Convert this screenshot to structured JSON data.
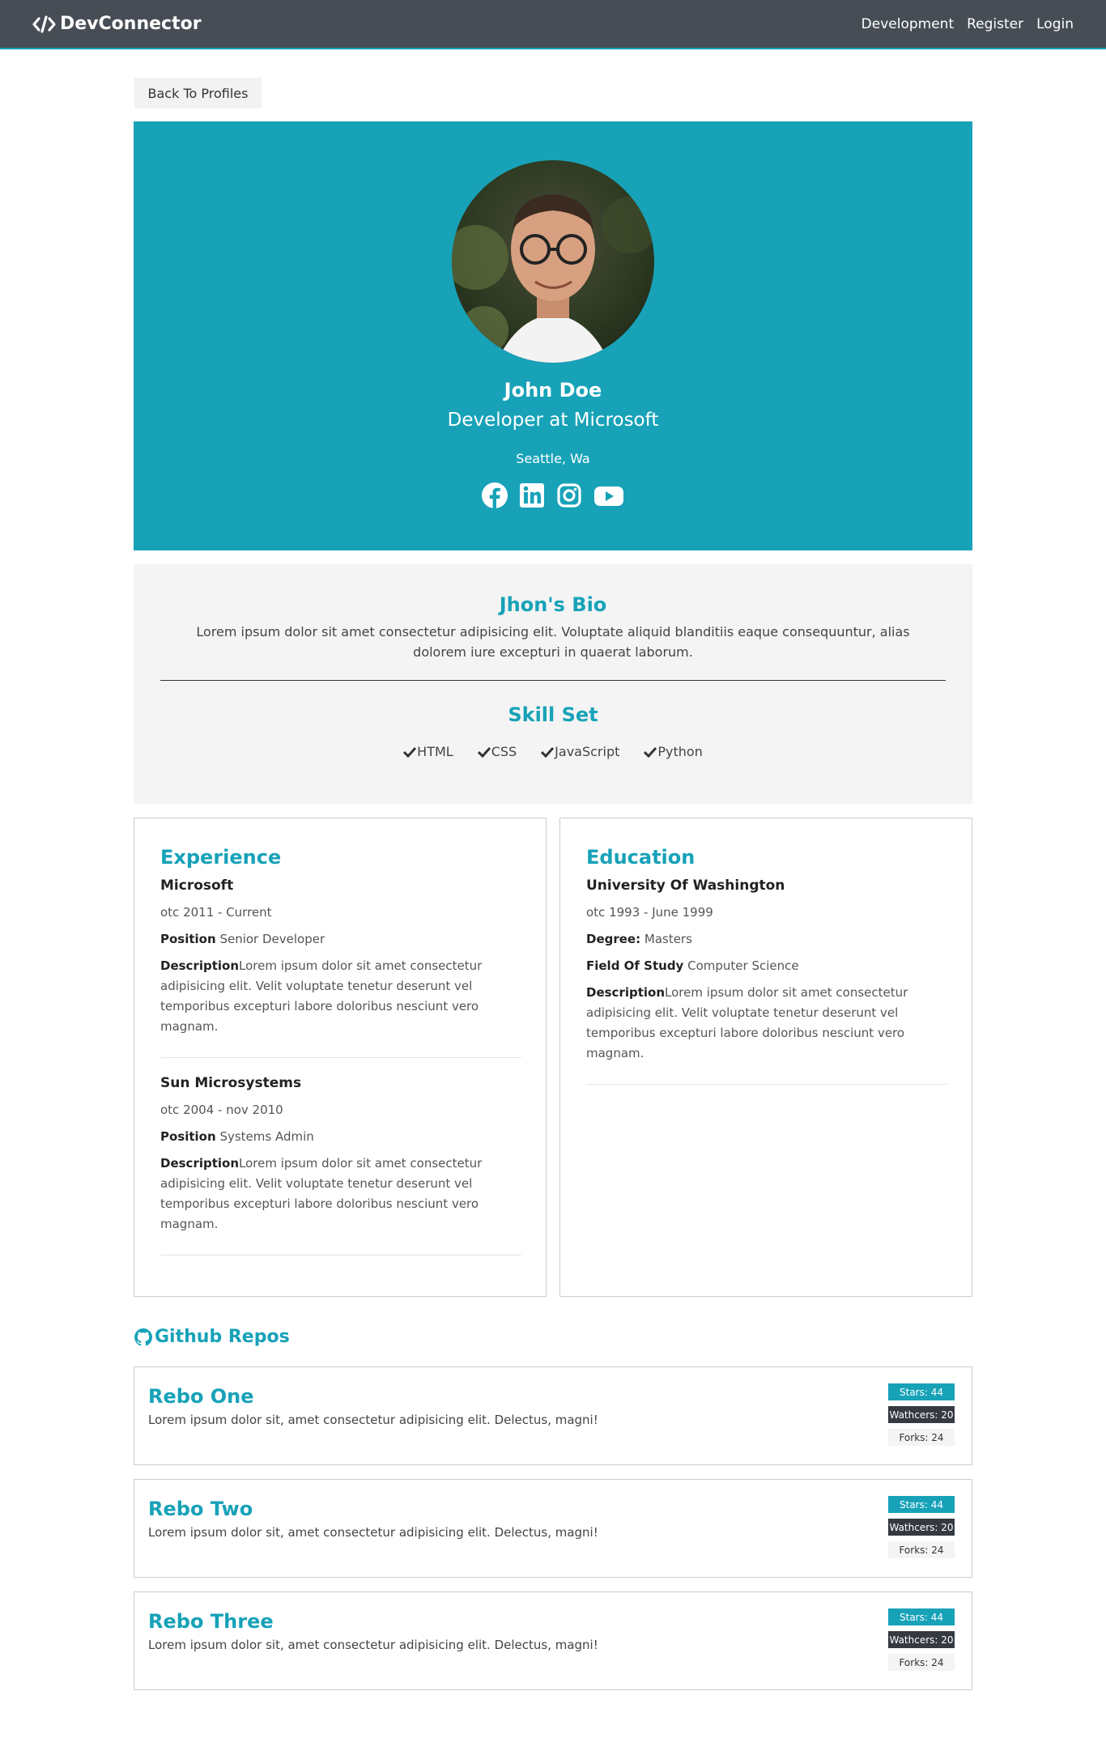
{
  "navbar": {
    "brand": "DevConnector",
    "links": [
      "Development",
      "Register",
      "Login"
    ]
  },
  "back_button": "Back To Profiles",
  "profile": {
    "name": "John Doe",
    "title": "Developer at Microsoft",
    "location": "Seattle, Wa",
    "socials": [
      "facebook-icon",
      "linkedin-icon",
      "instagram-icon",
      "youtube-icon"
    ]
  },
  "about": {
    "bio_heading": "Jhon's Bio",
    "bio_text": "Lorem ipsum dolor sit amet consectetur adipisicing elit. Voluptate aliquid blanditiis eaque consequuntur, alias dolorem iure excepturi in quaerat laborum.",
    "skills_heading": "Skill Set",
    "skills": [
      "HTML",
      "CSS",
      "JavaScript",
      "Python"
    ]
  },
  "experience": {
    "heading": "Experience",
    "items": [
      {
        "company": "Microsoft",
        "dates": "otc 2011 - Current",
        "position_label": "Position",
        "position": " Senior Developer",
        "description_label": "Description",
        "description": "Lorem ipsum dolor sit amet consectetur adipisicing elit. Velit voluptate tenetur deserunt vel temporibus excepturi labore doloribus nesciunt vero magnam."
      },
      {
        "company": "Sun Microsystems",
        "dates": "otc 2004 - nov 2010",
        "position_label": "Position",
        "position": " Systems Admin",
        "description_label": "Description",
        "description": "Lorem ipsum dolor sit amet consectetur adipisicing elit. Velit voluptate tenetur deserunt vel temporibus excepturi labore doloribus nesciunt vero magnam."
      }
    ]
  },
  "education": {
    "heading": "Education",
    "items": [
      {
        "school": "University Of Washington",
        "dates": "otc 1993 - June 1999",
        "degree_label": "Degree:",
        "degree": " Masters",
        "field_label": "Field Of Study",
        "field": " Computer Science",
        "description_label": "Description",
        "description": "Lorem ipsum dolor sit amet consectetur adipisicing elit. Velit voluptate tenetur deserunt vel temporibus excepturi labore doloribus nesciunt vero magnam."
      }
    ]
  },
  "github": {
    "heading": "Github Repos",
    "repos": [
      {
        "name": "Rebo One",
        "description": "Lorem ipsum dolor sit, amet consectetur adipisicing elit. Delectus, magni!",
        "stars": "Stars: 44",
        "watchers": "Wathcers: 20",
        "forks": "Forks: 24"
      },
      {
        "name": "Rebo Two",
        "description": "Lorem ipsum dolor sit, amet consectetur adipisicing elit. Delectus, magni!",
        "stars": "Stars: 44",
        "watchers": "Wathcers: 20",
        "forks": "Forks: 24"
      },
      {
        "name": "Rebo Three",
        "description": "Lorem ipsum dolor sit, amet consectetur adipisicing elit. Delectus, magni!",
        "stars": "Stars: 44",
        "watchers": "Wathcers: 20",
        "forks": "Forks: 24"
      }
    ]
  },
  "colors": {
    "accent": "#17a2b8",
    "navbar": "#474d54",
    "light": "#f4f4f4",
    "dark": "#343a40"
  }
}
